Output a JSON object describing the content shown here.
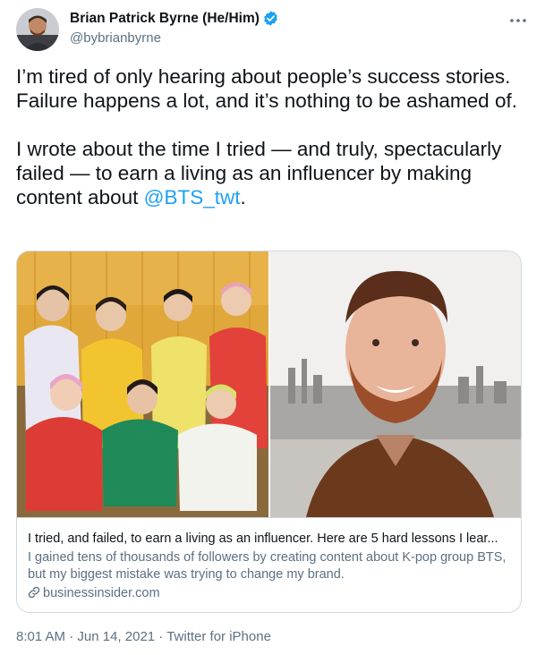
{
  "author": {
    "display_name": "Brian Patrick Byrne (He/Him)",
    "handle": "@bybrianbyrne",
    "verified": true
  },
  "tweet": {
    "text_before_mention": "I’m tired of only hearing about people’s success stories. Failure happens a lot, and it’s nothing to be ashamed of.\n\nI wrote about the time I tried — and truly, spectacularly failed — to earn a living as an influencer by making content about ",
    "mention": "@BTS_twt",
    "text_after_mention": "."
  },
  "card": {
    "title": "I tried, and failed, to earn a living as an influencer. Here are 5 hard lessons I lear...",
    "description": "I gained tens of thousands of followers by creating content about K-pop group BTS, but my biggest mistake was trying to change my brand.",
    "domain": "businessinsider.com",
    "images": [
      "bts-group-photo",
      "author-portrait"
    ]
  },
  "footer": {
    "time": "8:01 AM",
    "separator": " · ",
    "date": "Jun 14, 2021",
    "source": "Twitter for iPhone"
  },
  "colors": {
    "link": "#1da1f2",
    "secondary_text": "#5b7083",
    "border": "#cfd9de",
    "verified": "#1da1f2"
  },
  "icons": [
    "verified-badge-icon",
    "more-options-icon",
    "link-icon"
  ]
}
